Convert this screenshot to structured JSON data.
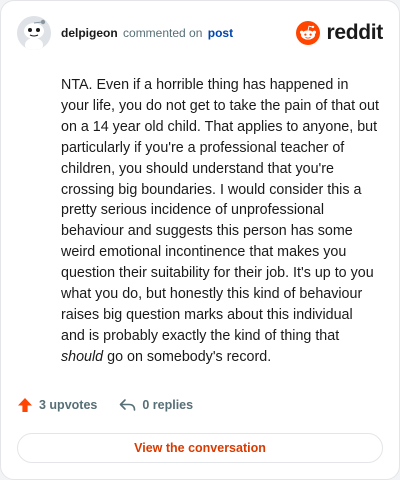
{
  "header": {
    "username": "delpigeon",
    "action": "commented on",
    "target": "post",
    "logo_text": "reddit"
  },
  "comment": {
    "text_before_italic": "NTA. Even if a horrible thing has happened in your life, you do not get to take the pain of that out on a 14 year old child. That applies to anyone, but particularly if you're a professional teacher of children, you should understand that you're crossing big boundaries. I would consider this a pretty serious incidence of unprofessional behaviour and suggests this person has some weird emotional incontinence that makes you question their suitability for their job. It's up to you what you do, but honestly this kind of behaviour raises big question marks about this individual and is probably exactly the kind of thing that ",
    "italic": "should",
    "text_after_italic": " go on somebody's record."
  },
  "stats": {
    "upvotes": "3 upvotes",
    "replies": "0 replies"
  },
  "cta_label": "View the conversation",
  "colors": {
    "brand": "#ff4500",
    "link": "#0045ac",
    "cta_text": "#d93a00",
    "muted": "#576f76"
  },
  "icons": [
    "avatar-snoo",
    "reddit-logo-icon",
    "upvote-arrow-icon",
    "reply-icon"
  ]
}
